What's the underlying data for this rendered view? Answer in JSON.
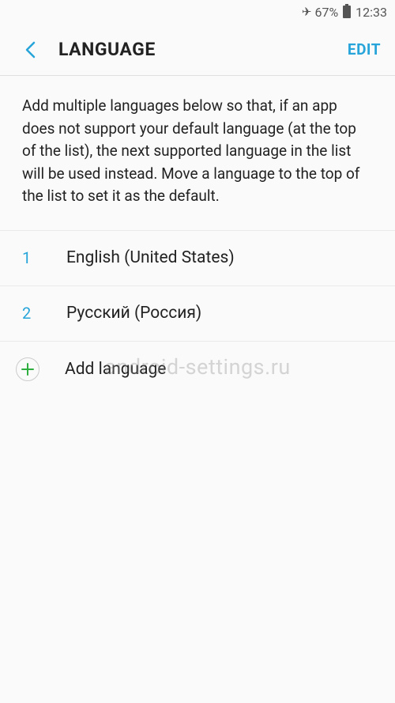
{
  "status": {
    "battery_pct": "67%",
    "time": "12:33"
  },
  "header": {
    "title": "LANGUAGE",
    "edit_label": "EDIT"
  },
  "description": "Add multiple languages below so that, if an app does not support your default language (at the top of the list), the next supported language in the list will be used instead. Move a language to the top of the list to set it as the default.",
  "languages": [
    {
      "num": "1",
      "label": "English (United States)"
    },
    {
      "num": "2",
      "label": "Русский (Россия)"
    }
  ],
  "add_label": "Add language",
  "watermark": "android-settings.ru"
}
